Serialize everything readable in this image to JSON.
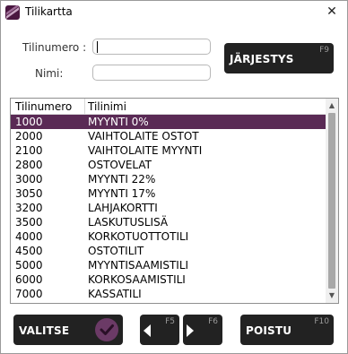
{
  "window": {
    "title": "Tilikartta",
    "close_glyph": "✕",
    "icon": "app-icon"
  },
  "form": {
    "account_number_label": "Tilinumero :",
    "account_number_value": "",
    "name_label": "Nimi:",
    "name_value": ""
  },
  "sort_button": {
    "label": "JÄRJESTYS",
    "fkey": "F9"
  },
  "list": {
    "columns": [
      "Tilinumero",
      "Tilinimi"
    ],
    "selected_index": 0,
    "rows": [
      {
        "number": "1000",
        "name": "MYYNTI 0%"
      },
      {
        "number": "2000",
        "name": "VAIHTOLAITE OSTOT"
      },
      {
        "number": "2100",
        "name": "VAIHTOLAITE MYYNTI"
      },
      {
        "number": "2800",
        "name": "OSTOVELAT"
      },
      {
        "number": "3000",
        "name": "MYYNTI 22%"
      },
      {
        "number": "3050",
        "name": "MYYNTI 17%"
      },
      {
        "number": "3200",
        "name": "LAHJAKORTTI"
      },
      {
        "number": "3500",
        "name": "LASKUTUSLISÄ"
      },
      {
        "number": "4000",
        "name": "KORKOTUOTTOTILI"
      },
      {
        "number": "4500",
        "name": "OSTOTILIT"
      },
      {
        "number": "5000",
        "name": "MYYNTISAAMISTILI"
      },
      {
        "number": "6000",
        "name": "KORKOSAAMISTILI"
      },
      {
        "number": "7000",
        "name": "KASSATILI"
      }
    ]
  },
  "footer": {
    "select_label": "VALITSE",
    "prev_fkey": "F5",
    "next_fkey": "F6",
    "exit_label": "POISTU",
    "exit_fkey": "F10"
  },
  "colors": {
    "accent": "#5a2a55",
    "button_dark": "#222222",
    "check_circle": "#6b3a66"
  }
}
